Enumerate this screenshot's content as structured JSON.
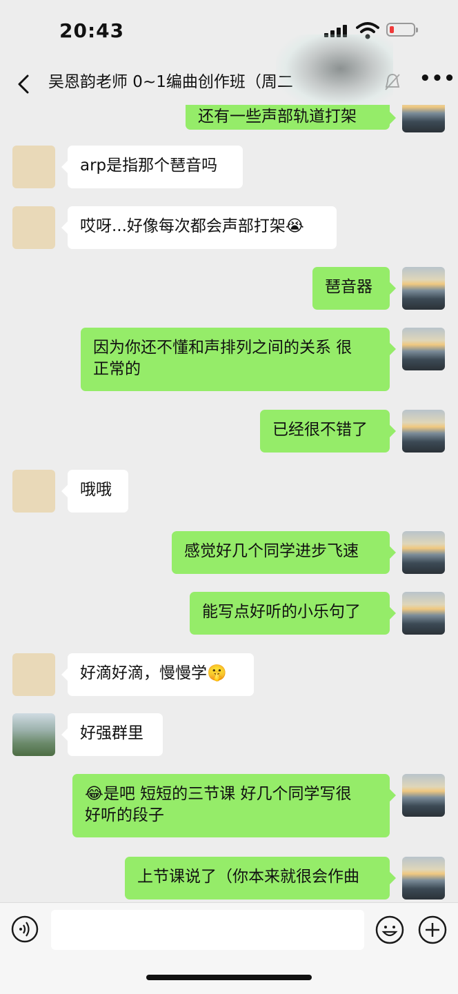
{
  "status_bar": {
    "time": "20:43"
  },
  "header": {
    "title": "吴恩韵老师 0~1编曲创作班（周二",
    "more_icon": "more-icon",
    "back_icon": "back-chevron-icon"
  },
  "messages": [
    {
      "side": "out",
      "text": "还有一些声部轨道打架"
    },
    {
      "side": "in",
      "avatar": "cat",
      "text": "arp是指那个琶音吗"
    },
    {
      "side": "in",
      "avatar": "cat",
      "text": "哎呀...好像每次都会声部打架😭"
    },
    {
      "side": "out",
      "text": "琶音器"
    },
    {
      "side": "out",
      "text": "因为你还不懂和声排列之间的关系 很\n正常的"
    },
    {
      "side": "out",
      "text": "已经很不错了"
    },
    {
      "side": "in",
      "avatar": "cat",
      "text": "哦哦"
    },
    {
      "side": "out",
      "text": "感觉好几个同学进步飞速"
    },
    {
      "side": "out",
      "text": "能写点好听的小乐句了"
    },
    {
      "side": "in",
      "avatar": "cat",
      "text": "好滴好滴，慢慢学🤫"
    },
    {
      "side": "in",
      "avatar": "piano",
      "text": "好强群里"
    },
    {
      "side": "out",
      "text": "😂是吧 短短的三节课 好几个同学写很\n好听的段子"
    },
    {
      "side": "out",
      "text": "上节课说了（你本来就很会作曲"
    }
  ],
  "input_bar": {
    "voice_icon": "voice-icon",
    "emoji_icon": "emoji-icon",
    "plus_icon": "plus-icon",
    "text_value": ""
  }
}
